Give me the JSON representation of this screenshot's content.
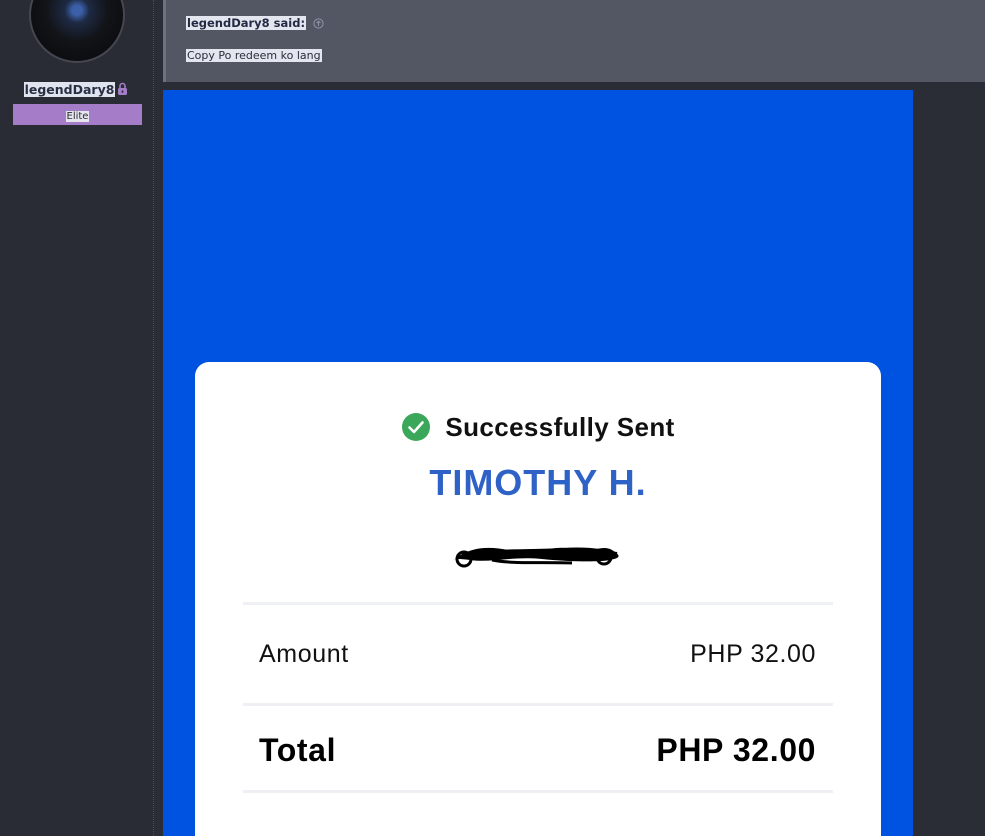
{
  "user": {
    "username": "legendDary8",
    "badge": "Elite"
  },
  "quote": {
    "author": "legendDary8 said:",
    "text": "Copy Po redeem ko lang"
  },
  "receipt": {
    "status": "Successfully Sent",
    "recipient": "TIMOTHY H.",
    "amount_label": "Amount",
    "amount_value": "PHP 32.00",
    "total_label": "Total",
    "total_value": "PHP 32.00"
  },
  "colors": {
    "screenshot_bg": "#0052e0",
    "recipient": "#2e62c6",
    "success": "#3aa75a",
    "badge": "#a47cc8"
  },
  "icons": {
    "avatar": "avatar-image",
    "lock": "lock-icon",
    "jump": "arrow-up-circle-icon",
    "check": "check-circle-icon"
  }
}
